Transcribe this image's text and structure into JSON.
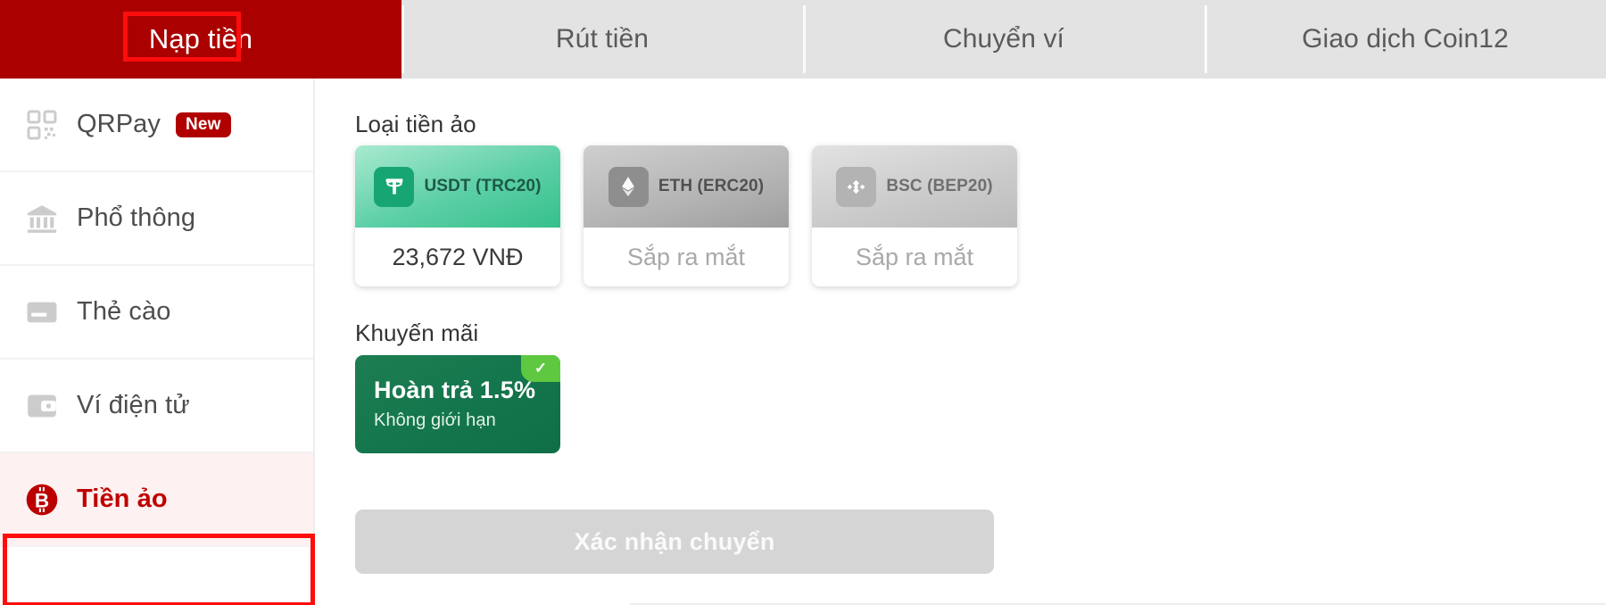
{
  "tabs": [
    {
      "label": "Nạp tiền",
      "active": true
    },
    {
      "label": "Rút tiền",
      "active": false
    },
    {
      "label": "Chuyển ví",
      "active": false
    },
    {
      "label": "Giao dịch Coin12",
      "active": false
    }
  ],
  "sidebar": {
    "items": [
      {
        "label": "QRPay",
        "icon": "qr-code-icon",
        "badge": "New",
        "active": false
      },
      {
        "label": "Phổ thông",
        "icon": "bank-icon",
        "badge": "",
        "active": false
      },
      {
        "label": "Thẻ cào",
        "icon": "card-icon",
        "badge": "",
        "active": false
      },
      {
        "label": "Ví điện tử",
        "icon": "wallet-icon",
        "badge": "",
        "active": false
      },
      {
        "label": "Tiền ảo",
        "icon": "bitcoin-icon",
        "badge": "",
        "active": true
      }
    ]
  },
  "main": {
    "coin_section_title": "Loại tiền ảo",
    "coins": [
      {
        "name": "USDT (TRC20)",
        "icon": "tether-icon",
        "value": "23,672 VNĐ",
        "state": "selected"
      },
      {
        "name": "ETH (ERC20)",
        "icon": "ethereum-icon",
        "value": "Sắp ra mắt",
        "state": "disabled"
      },
      {
        "name": "BSC (BEP20)",
        "icon": "binance-icon",
        "value": "Sắp ra mắt",
        "state": "disabled"
      }
    ],
    "promo_section_title": "Khuyến mãi",
    "promo": {
      "title": "Hoàn trả 1.5%",
      "subtitle": "Không giới hạn",
      "selected_mark": "✓"
    },
    "confirm_label": "Xác nhận chuyển"
  },
  "colors": {
    "brand_red": "#aa0000",
    "annotation_red": "#ff0d0d",
    "active_item_bg": "#fdf1f1",
    "active_item_text": "#c00000",
    "usdt_green": "#36c08c",
    "promo_green": "#15774d",
    "badge_green": "#5ec840",
    "disabled_gray": "#d5d5d5"
  }
}
